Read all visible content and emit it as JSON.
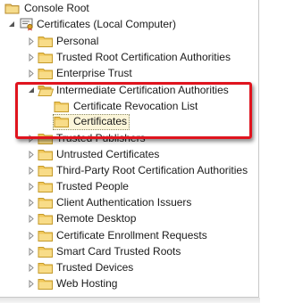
{
  "tree": {
    "console_root": "Console Root",
    "certificates_local": "Certificates (Local Computer)",
    "stores": {
      "personal": "Personal",
      "trusted_root": "Trusted Root Certification Authorities",
      "enterprise_trust": "Enterprise Trust",
      "intermediate": "Intermediate Certification Authorities",
      "crl": "Certificate Revocation List",
      "certificates": "Certificates",
      "trusted_publishers": "Trusted Publishers",
      "untrusted": "Untrusted Certificates",
      "third_party_root": "Third-Party Root Certification Authorities",
      "trusted_people": "Trusted People",
      "client_auth_issuers": "Client Authentication Issuers",
      "remote_desktop": "Remote Desktop",
      "enrollment_requests": "Certificate Enrollment Requests",
      "smart_card_roots": "Smart Card Trusted Roots",
      "trusted_devices": "Trusted Devices",
      "web_hosting": "Web Hosting"
    },
    "selected_item": "Certificates"
  },
  "colors": {
    "highlight_border": "#e0141e",
    "selection_fill": "#fbf5d9",
    "folder_yellow": "#f1c75a"
  }
}
